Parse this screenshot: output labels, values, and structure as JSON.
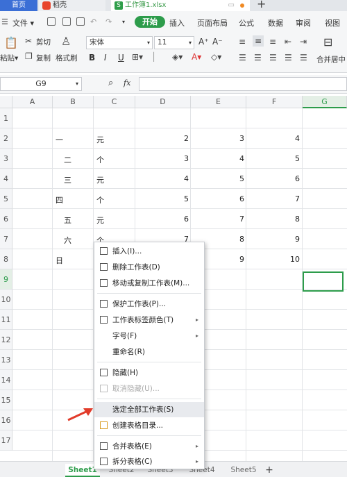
{
  "tabs": {
    "home": "首页",
    "daoke": "稻壳",
    "workbook": "工作簿1.xlsx",
    "workbook_icon": "S"
  },
  "menu": {
    "file": "文件",
    "start": "开始",
    "insert": "插入",
    "page_layout": "页面布局",
    "formula": "公式",
    "data": "数据",
    "review": "审阅",
    "view": "视图"
  },
  "ribbon": {
    "paste": "粘贴",
    "cut": "剪切",
    "copy": "复制",
    "format_painter": "格式刷",
    "font_name": "宋体",
    "font_size": "11",
    "grow_font": "A⁺",
    "shrink_font": "A⁻",
    "bold": "B",
    "italic": "I",
    "underline": "U",
    "merge_center": "合并居中"
  },
  "formula_bar": {
    "cell_ref": "G9",
    "fx": "fx"
  },
  "columns": [
    "A",
    "B",
    "C",
    "D",
    "E",
    "F",
    "G"
  ],
  "rows": [
    "1",
    "2",
    "3",
    "4",
    "5",
    "6",
    "7",
    "8",
    "9",
    "10",
    "11",
    "12",
    "13",
    "14",
    "15",
    "16",
    "17"
  ],
  "cells": {
    "b2": "一",
    "c2": "元",
    "d2": "2",
    "e2": "3",
    "f2": "4",
    "b3": "二",
    "c3": "个",
    "d3": "3",
    "e3": "4",
    "f3": "5",
    "b4": "三",
    "c4": "元",
    "d4": "4",
    "e4": "5",
    "f4": "6",
    "b5": "四",
    "c5": "个",
    "d5": "5",
    "e5": "6",
    "f5": "7",
    "b6": "五",
    "c6": "元",
    "d6": "6",
    "e6": "7",
    "f6": "8",
    "b7": "六",
    "c7": "个",
    "d7": "7",
    "e7": "8",
    "f7": "9",
    "b8": "日",
    "e8": "9",
    "f8": "10"
  },
  "context_menu": [
    "插入(I)...",
    "删除工作表(D)",
    "移动或复制工作表(M)...",
    "保护工作表(P)...",
    "工作表标签颜色(T)",
    "字号(F)",
    "重命名(R)",
    "隐藏(H)",
    "取消隐藏(U)...",
    "选定全部工作表(S)",
    "创建表格目录...",
    "合并表格(E)",
    "拆分表格(C)"
  ],
  "sheets": [
    "Sheet1",
    "Sheet2",
    "Sheet3",
    "Sheet4",
    "Sheet5"
  ],
  "colors": {
    "accent_green": "#2d9c4b",
    "home_tab_blue": "#3b6fd6",
    "arrow_red": "#e23b2a"
  }
}
